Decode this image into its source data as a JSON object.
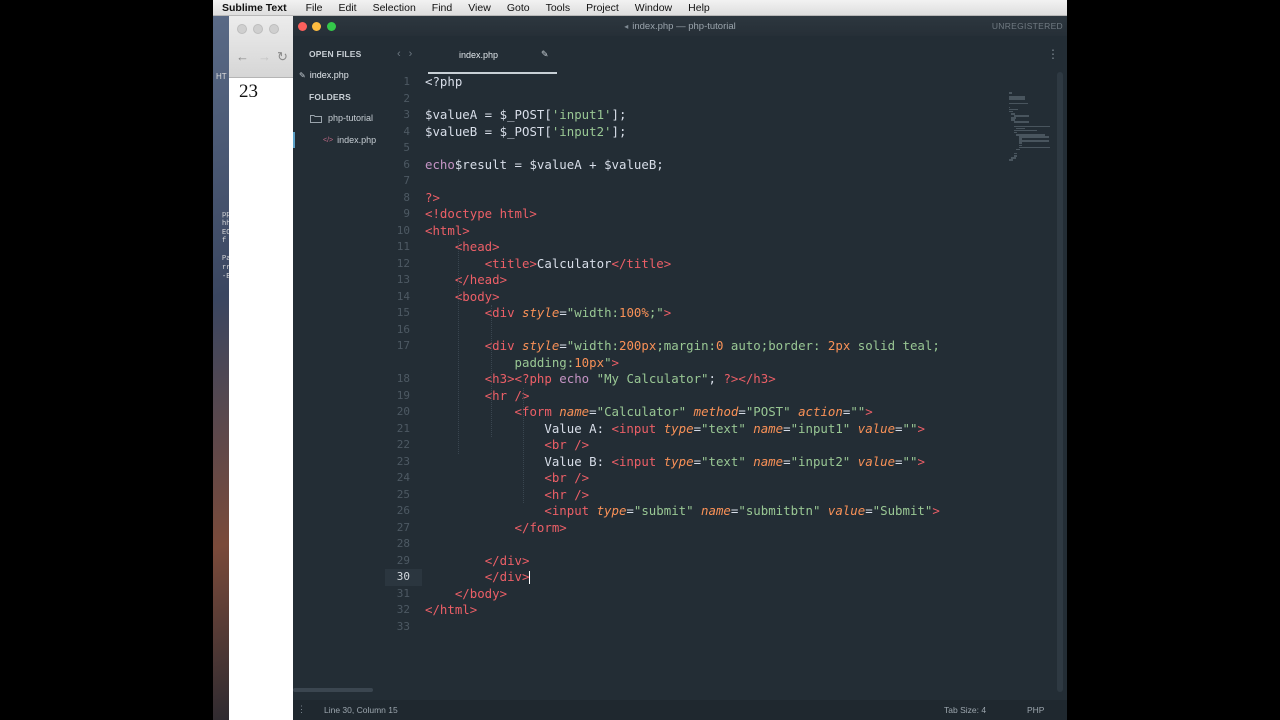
{
  "menubar": {
    "app_name": "Sublime Text",
    "items": [
      "File",
      "Edit",
      "Selection",
      "Find",
      "View",
      "Goto",
      "Tools",
      "Project",
      "Window",
      "Help"
    ]
  },
  "browser": {
    "page_value": "23",
    "tab_fragment": "HT"
  },
  "window": {
    "title": "index.php — php-tutorial",
    "unregistered": "UNREGISTERED",
    "traffic_colors": [
      "#fc605c",
      "#fdbc40",
      "#34c84a"
    ]
  },
  "sidebar": {
    "open_files_label": "OPEN FILES",
    "open_file": "index.php",
    "folders_label": "FOLDERS",
    "folder_name": "php-tutorial",
    "folder_file": "index.php"
  },
  "tab": {
    "label": "index.php"
  },
  "editor": {
    "current_line": 30,
    "lines": [
      {
        "n": "1",
        "tokens": [
          [
            "php",
            "<?php"
          ]
        ]
      },
      {
        "n": "2",
        "tokens": []
      },
      {
        "n": "3",
        "tokens": [
          [
            "var",
            "$valueA"
          ],
          [
            "op",
            " = "
          ],
          [
            "var",
            "$_POST"
          ],
          [
            "op",
            "["
          ],
          [
            "str",
            "'input1'"
          ],
          [
            "op",
            "];"
          ]
        ]
      },
      {
        "n": "4",
        "tokens": [
          [
            "var",
            "$valueB"
          ],
          [
            "op",
            " = "
          ],
          [
            "var",
            "$_POST"
          ],
          [
            "op",
            "["
          ],
          [
            "str",
            "'input2'"
          ],
          [
            "op",
            "];"
          ]
        ]
      },
      {
        "n": "5",
        "tokens": []
      },
      {
        "n": "6",
        "tokens": [
          [
            "echo",
            "echo"
          ],
          [
            "var",
            "$result"
          ],
          [
            "op",
            " = "
          ],
          [
            "var",
            "$valueA"
          ],
          [
            "op",
            " + "
          ],
          [
            "var",
            "$valueB"
          ],
          [
            "op",
            ";"
          ]
        ]
      },
      {
        "n": "7",
        "tokens": []
      },
      {
        "n": "8",
        "tokens": [
          [
            "tag",
            "?>"
          ]
        ]
      },
      {
        "n": "9",
        "tokens": [
          [
            "tag",
            "<!doctype html>"
          ]
        ]
      },
      {
        "n": "10",
        "tokens": [
          [
            "tag",
            "<html>"
          ]
        ]
      },
      {
        "n": "11",
        "tokens": [
          [
            "plain",
            "    "
          ],
          [
            "tag",
            "<head>"
          ]
        ]
      },
      {
        "n": "12",
        "tokens": [
          [
            "plain",
            "        "
          ],
          [
            "tag",
            "<title>"
          ],
          [
            "plain",
            "Calculator"
          ],
          [
            "tag",
            "</title>"
          ]
        ]
      },
      {
        "n": "13",
        "tokens": [
          [
            "plain",
            "    "
          ],
          [
            "tag",
            "</head>"
          ]
        ]
      },
      {
        "n": "14",
        "tokens": [
          [
            "plain",
            "    "
          ],
          [
            "tag",
            "<body>"
          ]
        ]
      },
      {
        "n": "15",
        "tokens": [
          [
            "plain",
            "        "
          ],
          [
            "tag",
            "<div "
          ],
          [
            "attr",
            "style"
          ],
          [
            "op",
            "="
          ],
          [
            "str",
            "\"width:"
          ],
          [
            "num",
            "100%"
          ],
          [
            "str",
            ";\""
          ],
          [
            "tag",
            ">"
          ]
        ]
      },
      {
        "n": "16",
        "tokens": []
      },
      {
        "n": "17",
        "tokens": [
          [
            "plain",
            "        "
          ],
          [
            "tag",
            "<div "
          ],
          [
            "attr",
            "style"
          ],
          [
            "op",
            "="
          ],
          [
            "str",
            "\"width:"
          ],
          [
            "num",
            "200px"
          ],
          [
            "str",
            ";margin:"
          ],
          [
            "num",
            "0"
          ],
          [
            "str",
            " auto;border: "
          ],
          [
            "num",
            "2px"
          ],
          [
            "str",
            " solid teal;"
          ]
        ]
      },
      {
        "n": "",
        "tokens": [
          [
            "plain",
            "            "
          ],
          [
            "str",
            "padding:"
          ],
          [
            "num",
            "10px"
          ],
          [
            "str",
            "\""
          ],
          [
            "tag",
            ">"
          ]
        ]
      },
      {
        "n": "18",
        "tokens": [
          [
            "plain",
            "        "
          ],
          [
            "tag",
            "<h3>"
          ],
          [
            "tag",
            "<?php "
          ],
          [
            "echo",
            "echo "
          ],
          [
            "str",
            "\"My Calculator\""
          ],
          [
            "op",
            "; "
          ],
          [
            "tag",
            "?>"
          ],
          [
            "tag",
            "</h3>"
          ]
        ]
      },
      {
        "n": "19",
        "tokens": [
          [
            "plain",
            "        "
          ],
          [
            "tag",
            "<hr />"
          ]
        ]
      },
      {
        "n": "20",
        "tokens": [
          [
            "plain",
            "            "
          ],
          [
            "tag",
            "<form "
          ],
          [
            "attr",
            "name"
          ],
          [
            "op",
            "="
          ],
          [
            "str",
            "\"Calculator\""
          ],
          [
            "plain",
            " "
          ],
          [
            "attr",
            "method"
          ],
          [
            "op",
            "="
          ],
          [
            "str",
            "\"POST\""
          ],
          [
            "plain",
            " "
          ],
          [
            "attr",
            "action"
          ],
          [
            "op",
            "="
          ],
          [
            "str",
            "\"\""
          ],
          [
            "tag",
            ">"
          ]
        ]
      },
      {
        "n": "21",
        "tokens": [
          [
            "plain",
            "                Value A: "
          ],
          [
            "tag",
            "<input "
          ],
          [
            "attr",
            "type"
          ],
          [
            "op",
            "="
          ],
          [
            "str",
            "\"text\""
          ],
          [
            "plain",
            " "
          ],
          [
            "attr",
            "name"
          ],
          [
            "op",
            "="
          ],
          [
            "str",
            "\"input1\""
          ],
          [
            "plain",
            " "
          ],
          [
            "attr",
            "value"
          ],
          [
            "op",
            "="
          ],
          [
            "str",
            "\"\""
          ],
          [
            "tag",
            ">"
          ]
        ]
      },
      {
        "n": "22",
        "tokens": [
          [
            "plain",
            "                "
          ],
          [
            "tag",
            "<br />"
          ]
        ]
      },
      {
        "n": "23",
        "tokens": [
          [
            "plain",
            "                Value B: "
          ],
          [
            "tag",
            "<input "
          ],
          [
            "attr",
            "type"
          ],
          [
            "op",
            "="
          ],
          [
            "str",
            "\"text\""
          ],
          [
            "plain",
            " "
          ],
          [
            "attr",
            "name"
          ],
          [
            "op",
            "="
          ],
          [
            "str",
            "\"input2\""
          ],
          [
            "plain",
            " "
          ],
          [
            "attr",
            "value"
          ],
          [
            "op",
            "="
          ],
          [
            "str",
            "\"\""
          ],
          [
            "tag",
            ">"
          ]
        ]
      },
      {
        "n": "24",
        "tokens": [
          [
            "plain",
            "                "
          ],
          [
            "tag",
            "<br />"
          ]
        ]
      },
      {
        "n": "25",
        "tokens": [
          [
            "plain",
            "                "
          ],
          [
            "tag",
            "<hr />"
          ]
        ]
      },
      {
        "n": "26",
        "tokens": [
          [
            "plain",
            "                "
          ],
          [
            "tag",
            "<input "
          ],
          [
            "attr",
            "type"
          ],
          [
            "op",
            "="
          ],
          [
            "str",
            "\"submit\""
          ],
          [
            "plain",
            " "
          ],
          [
            "attr",
            "name"
          ],
          [
            "op",
            "="
          ],
          [
            "str",
            "\"submitbtn\""
          ],
          [
            "plain",
            " "
          ],
          [
            "attr",
            "value"
          ],
          [
            "op",
            "="
          ],
          [
            "str",
            "\"Submit\""
          ],
          [
            "tag",
            ">"
          ]
        ]
      },
      {
        "n": "27",
        "tokens": [
          [
            "plain",
            "            "
          ],
          [
            "tag",
            "</form>"
          ]
        ]
      },
      {
        "n": "28",
        "tokens": []
      },
      {
        "n": "29",
        "tokens": [
          [
            "plain",
            "        "
          ],
          [
            "tag",
            "</div>"
          ]
        ]
      },
      {
        "n": "30",
        "tokens": [
          [
            "plain",
            "        "
          ],
          [
            "tag",
            "</div>"
          ]
        ]
      },
      {
        "n": "31",
        "tokens": [
          [
            "plain",
            "    "
          ],
          [
            "tag",
            "</body>"
          ]
        ]
      },
      {
        "n": "32",
        "tokens": [
          [
            "tag",
            "</html>"
          ]
        ]
      },
      {
        "n": "33",
        "tokens": []
      }
    ]
  },
  "statusbar": {
    "position": "Line 30, Column 15",
    "tab_size": "Tab Size: 4",
    "syntax": "PHP"
  },
  "desktop_glyphs": "pp;E.He\nhhEEE\nECTRAH\nf\n\nPaCEC\nrrRRCE\n-EPE"
}
